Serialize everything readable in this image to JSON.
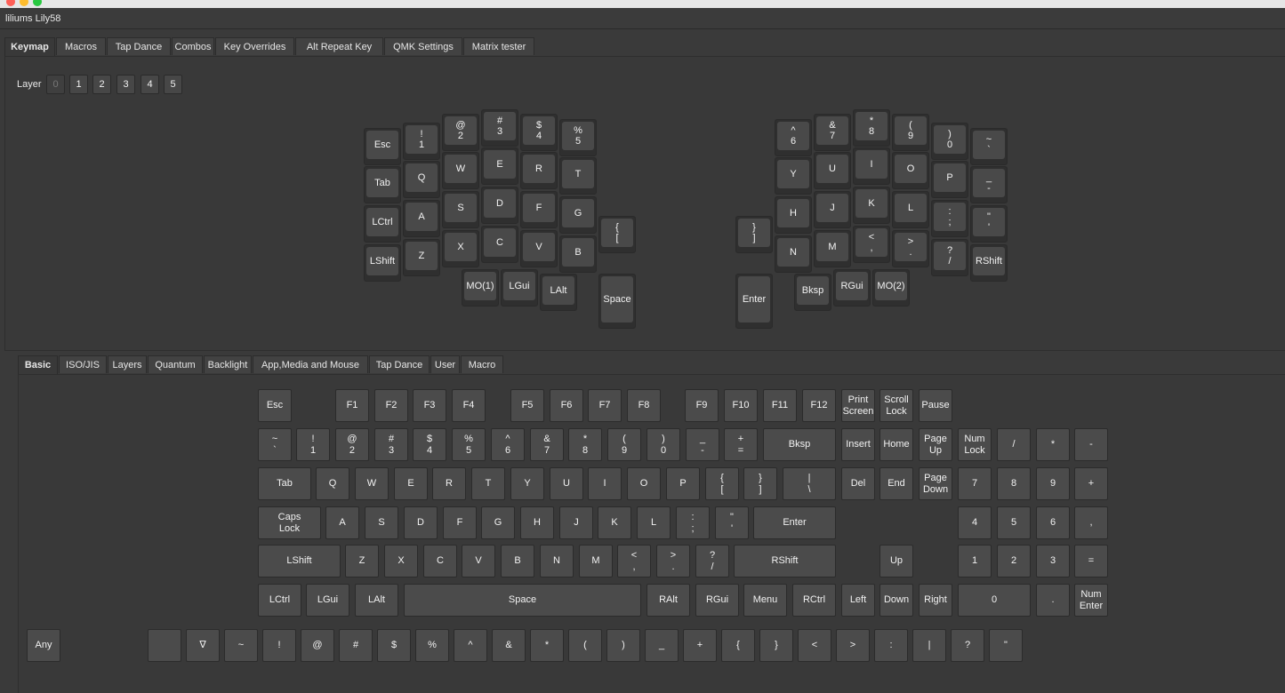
{
  "window": {
    "title": "liliums Lily58"
  },
  "main_tabs": [
    "Keymap",
    "Macros",
    "Tap Dance",
    "Combos",
    "Key Overrides",
    "Alt Repeat Key",
    "QMK Settings",
    "Matrix tester"
  ],
  "layer": {
    "label": "Layer",
    "buttons": [
      "0",
      "1",
      "2",
      "3",
      "4",
      "5"
    ],
    "active": "0"
  },
  "keymap": {
    "left": [
      "Esc",
      "!\n1",
      "@\n2",
      "#\n3",
      "$\n4",
      "%\n5",
      "Tab",
      "Q",
      "W",
      "E",
      "R",
      "T",
      "LCtrl",
      "A",
      "S",
      "D",
      "F",
      "G",
      "LShift",
      "Z",
      "X",
      "C",
      "V",
      "B",
      "{\n[",
      "MO(1)",
      "LGui",
      "LAlt",
      "Space"
    ],
    "right": [
      "^\n6",
      "&\n7",
      "*\n8",
      "(\n9",
      ")\n0",
      "~\n`",
      "Y",
      "U",
      "I",
      "O",
      "P",
      "_\n-",
      "H",
      "J",
      "K",
      "L",
      ":\n;",
      "\"\n'",
      "}\n]",
      "N",
      "M",
      "<\n,",
      ">\n.",
      "?\n/",
      "RShift",
      "Enter",
      "Bksp",
      "RGui",
      "MO(2)"
    ]
  },
  "bottom_tabs": [
    "Basic",
    "ISO/JIS",
    "Layers",
    "Quantum",
    "Backlight",
    "App,Media and Mouse",
    "Tap Dance",
    "User",
    "Macro"
  ],
  "basic": {
    "row0": [
      "Esc",
      "F1",
      "F2",
      "F3",
      "F4",
      "F5",
      "F6",
      "F7",
      "F8",
      "F9",
      "F10",
      "F11",
      "F12",
      "Print\nScreen",
      "Scroll\nLock",
      "Pause"
    ],
    "row1": [
      "~\n`",
      "!\n1",
      "@\n2",
      "#\n3",
      "$\n4",
      "%\n5",
      "^\n6",
      "&\n7",
      "*\n8",
      "(\n9",
      ")\n0",
      "_\n-",
      "+\n=",
      "Bksp",
      "Insert",
      "Home",
      "Page\nUp",
      "Num\nLock",
      "/",
      "*",
      "-"
    ],
    "row2": [
      "Tab",
      "Q",
      "W",
      "E",
      "R",
      "T",
      "Y",
      "U",
      "I",
      "O",
      "P",
      "{\n[",
      "}\n]",
      "|\n\\",
      "Del",
      "End",
      "Page\nDown",
      "7",
      "8",
      "9",
      "+"
    ],
    "row3": [
      "Caps\nLock",
      "A",
      "S",
      "D",
      "F",
      "G",
      "H",
      "J",
      "K",
      "L",
      ":\n;",
      "\"\n'",
      "Enter",
      "4",
      "5",
      "6",
      ","
    ],
    "row4": [
      "LShift",
      "Z",
      "X",
      "C",
      "V",
      "B",
      "N",
      "M",
      "<\n,",
      ">\n.",
      "?\n/",
      "RShift",
      "Up",
      "1",
      "2",
      "3",
      "="
    ],
    "row5": [
      "LCtrl",
      "LGui",
      "LAlt",
      "Space",
      "RAlt",
      "RGui",
      "Menu",
      "RCtrl",
      "Left",
      "Down",
      "Right",
      "0",
      ".",
      "Num\nEnter"
    ],
    "row6": [
      "Any",
      "",
      "∇",
      "~",
      "!",
      "@",
      "#",
      "$",
      "%",
      "^",
      "&",
      "*",
      "(",
      ")",
      "_",
      "+",
      "{",
      "}",
      "<",
      ">",
      ":",
      "|",
      "?",
      "\""
    ]
  }
}
